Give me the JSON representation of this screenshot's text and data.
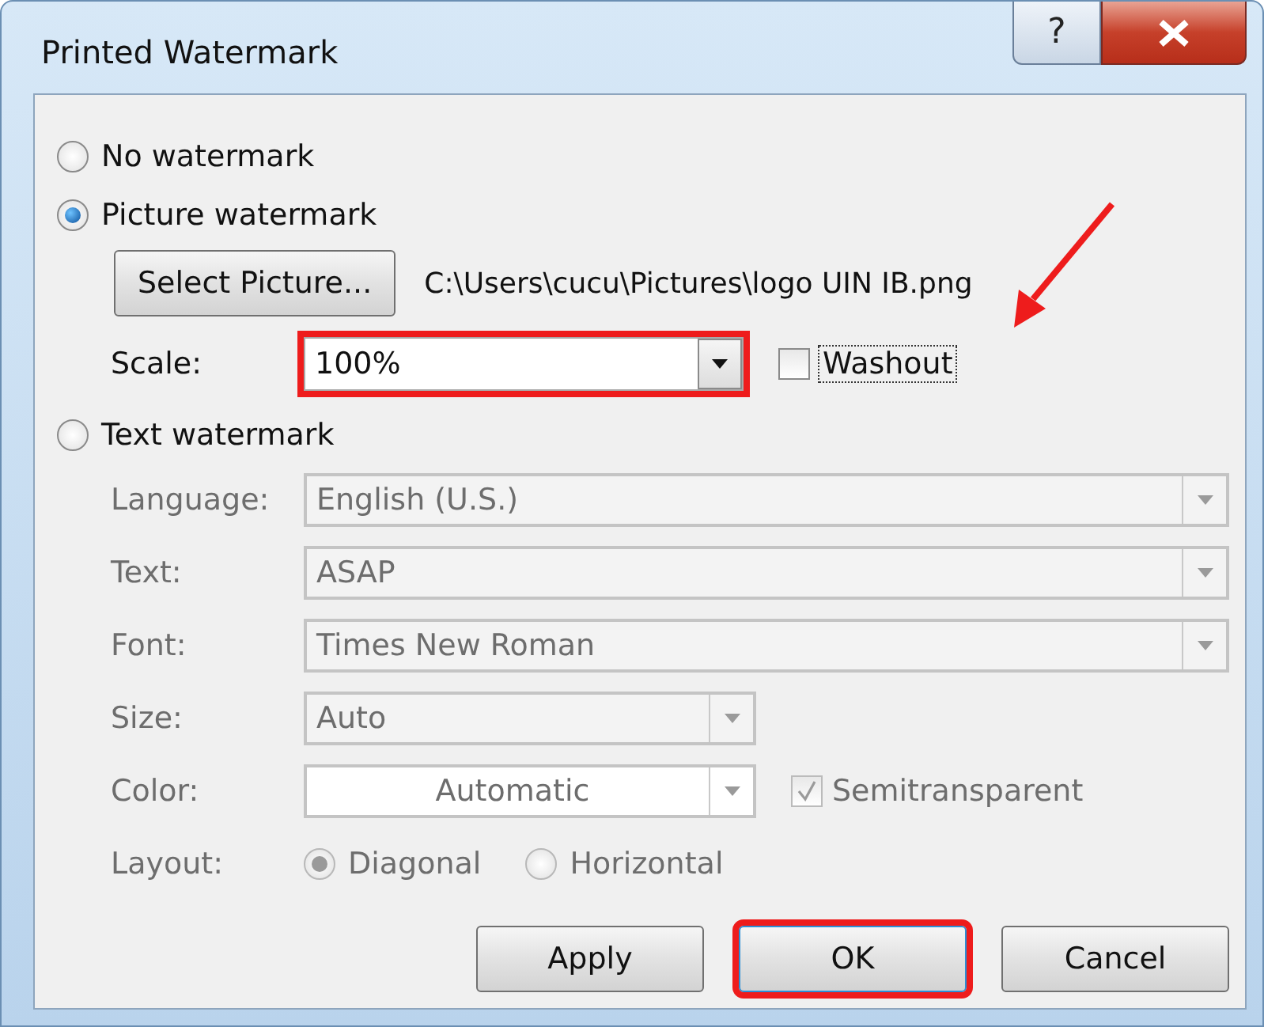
{
  "window": {
    "title": "Printed Watermark",
    "help_label": "?"
  },
  "no_watermark": {
    "label": "No watermark",
    "selected": false
  },
  "picture_watermark": {
    "label": "Picture watermark",
    "selected": true,
    "select_button": "Select Picture...",
    "path": "C:\\Users\\cucu\\Pictures\\logo UIN IB.png",
    "scale": {
      "label": "Scale:",
      "value": "100%",
      "highlighted": true
    },
    "washout": {
      "label": "Washout",
      "checked": false,
      "focused": true
    }
  },
  "text_watermark": {
    "label": "Text watermark",
    "selected": false,
    "disabled": true,
    "fields": [
      {
        "label": "Language:",
        "value": "English (U.S.)",
        "kind": "wide"
      },
      {
        "label": "Text:",
        "value": "ASAP",
        "kind": "wide"
      },
      {
        "label": "Font:",
        "value": "Times New Roman",
        "kind": "wide"
      },
      {
        "label": "Size:",
        "value": "Auto",
        "kind": "narrow"
      },
      {
        "label": "Color:",
        "value": "Automatic",
        "kind": "color"
      }
    ],
    "semitransparent": {
      "label": "Semitransparent",
      "checked": true
    },
    "layout": {
      "label": "Layout:",
      "options": [
        {
          "label": "Diagonal",
          "selected": true
        },
        {
          "label": "Horizontal",
          "selected": false
        }
      ]
    }
  },
  "buttons": [
    {
      "label": "Apply",
      "highlighted": false
    },
    {
      "label": "OK",
      "highlighted": true
    },
    {
      "label": "Cancel",
      "highlighted": false
    }
  ],
  "annotations": [
    {
      "kind": "arrow"
    }
  ]
}
